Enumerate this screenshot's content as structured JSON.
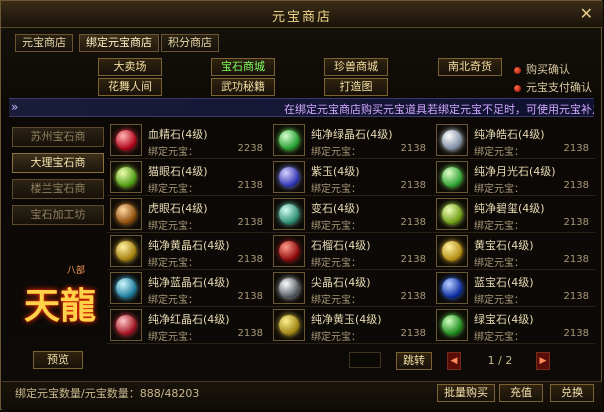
{
  "title": "元宝商店",
  "tabs": [
    "元宝商店",
    "绑定元宝商店",
    "积分商店"
  ],
  "categories": [
    {
      "label": "大卖场",
      "green": false
    },
    {
      "label": "宝石商城",
      "green": true
    },
    {
      "label": "珍兽商城",
      "green": false
    },
    {
      "label": "南北奇货",
      "green": false
    },
    {
      "label": "花舞人间",
      "green": false
    },
    {
      "label": "武功秘籍",
      "green": false
    },
    {
      "label": "打造图",
      "green": false
    }
  ],
  "options": [
    "购买确认",
    "元宝支付确认"
  ],
  "marquee": "在绑定元宝商店购买元宝道具若绑定元宝不足时，可使用元宝补足",
  "side_menu": [
    {
      "label": "苏州宝石商",
      "active": false
    },
    {
      "label": "大理宝石商",
      "active": true
    },
    {
      "label": "楼兰宝石商",
      "active": false
    },
    {
      "label": "宝石加工坊",
      "active": false
    }
  ],
  "logo": {
    "text": "天龍",
    "sub": "八部"
  },
  "preview_label": "预览",
  "price_label": "绑定元宝：",
  "gems": [
    {
      "name": "血精石(4级)",
      "price": "2238",
      "c1": "#ffb3b3",
      "c2": "#b00018",
      "glow": "#ff3040"
    },
    {
      "name": "纯净绿晶石(4级)",
      "price": "2138",
      "c1": "#d8ffd0",
      "c2": "#1d9a2a",
      "glow": "#6aff5a"
    },
    {
      "name": "纯净皓石(4级)",
      "price": "2138",
      "c1": "#ffffff",
      "c2": "#7a8aa0",
      "glow": "#e6f0ff"
    },
    {
      "name": "猫眼石(4级)",
      "price": "2138",
      "c1": "#f0ffb0",
      "c2": "#4a9a10",
      "glow": "#b8ff40"
    },
    {
      "name": "紫玉(4级)",
      "price": "2138",
      "c1": "#d8d0ff",
      "c2": "#2a30b0",
      "glow": "#8090ff"
    },
    {
      "name": "纯净月光石(4级)",
      "price": "2138",
      "c1": "#e0ffc8",
      "c2": "#2aa030",
      "glow": "#80ff60"
    },
    {
      "name": "虎眼石(4级)",
      "price": "2138",
      "c1": "#ffd8a0",
      "c2": "#8a4a08",
      "glow": "#e09030"
    },
    {
      "name": "变石(4级)",
      "price": "2138",
      "c1": "#d0fff0",
      "c2": "#2a8a70",
      "glow": "#70e0c0"
    },
    {
      "name": "纯净碧玺(4级)",
      "price": "2138",
      "c1": "#f0ffb8",
      "c2": "#6a9a10",
      "glow": "#c8ff50"
    },
    {
      "name": "纯净黄晶石(4级)",
      "price": "2138",
      "c1": "#fff0a0",
      "c2": "#a07a08",
      "glow": "#ffd040"
    },
    {
      "name": "石榴石(4级)",
      "price": "2138",
      "c1": "#ff9a8a",
      "c2": "#8a0808",
      "glow": "#d02020"
    },
    {
      "name": "黄宝石(4级)",
      "price": "2138",
      "c1": "#fff0a0",
      "c2": "#b08a10",
      "glow": "#ffc830"
    },
    {
      "name": "纯净蓝晶石(4级)",
      "price": "2138",
      "c1": "#d0f8ff",
      "c2": "#1a7a9a",
      "glow": "#50d0ff"
    },
    {
      "name": "尖晶石(4级)",
      "price": "2138",
      "c1": "#ffffff",
      "c2": "#505860",
      "glow": "#d0d8e0"
    },
    {
      "name": "蓝宝石(4级)",
      "price": "2138",
      "c1": "#b8d0ff",
      "c2": "#0a2aa0",
      "glow": "#3070ff"
    },
    {
      "name": "纯净红晶石(4级)",
      "price": "2138",
      "c1": "#ffc8c8",
      "c2": "#a01020",
      "glow": "#ff4050"
    },
    {
      "name": "纯净黄玉(4级)",
      "price": "2138",
      "c1": "#fff090",
      "c2": "#9a8010",
      "glow": "#f0d040"
    },
    {
      "name": "绿宝石(4级)",
      "price": "2138",
      "c1": "#d0ffc0",
      "c2": "#1a8a1a",
      "glow": "#60ff50"
    }
  ],
  "pager": {
    "jump_label": "跳转",
    "current": "1",
    "total": "2",
    "sep": "/",
    "prev_icon": "◀",
    "next_icon": "▶"
  },
  "bottom": {
    "qty_label": "绑定元宝数量/元宝数量：",
    "bound_amount": "888",
    "amount": "48203",
    "batch_buy": "批量购买",
    "recharge": "充值",
    "exchange": "兑换"
  },
  "close_icon": "✕"
}
